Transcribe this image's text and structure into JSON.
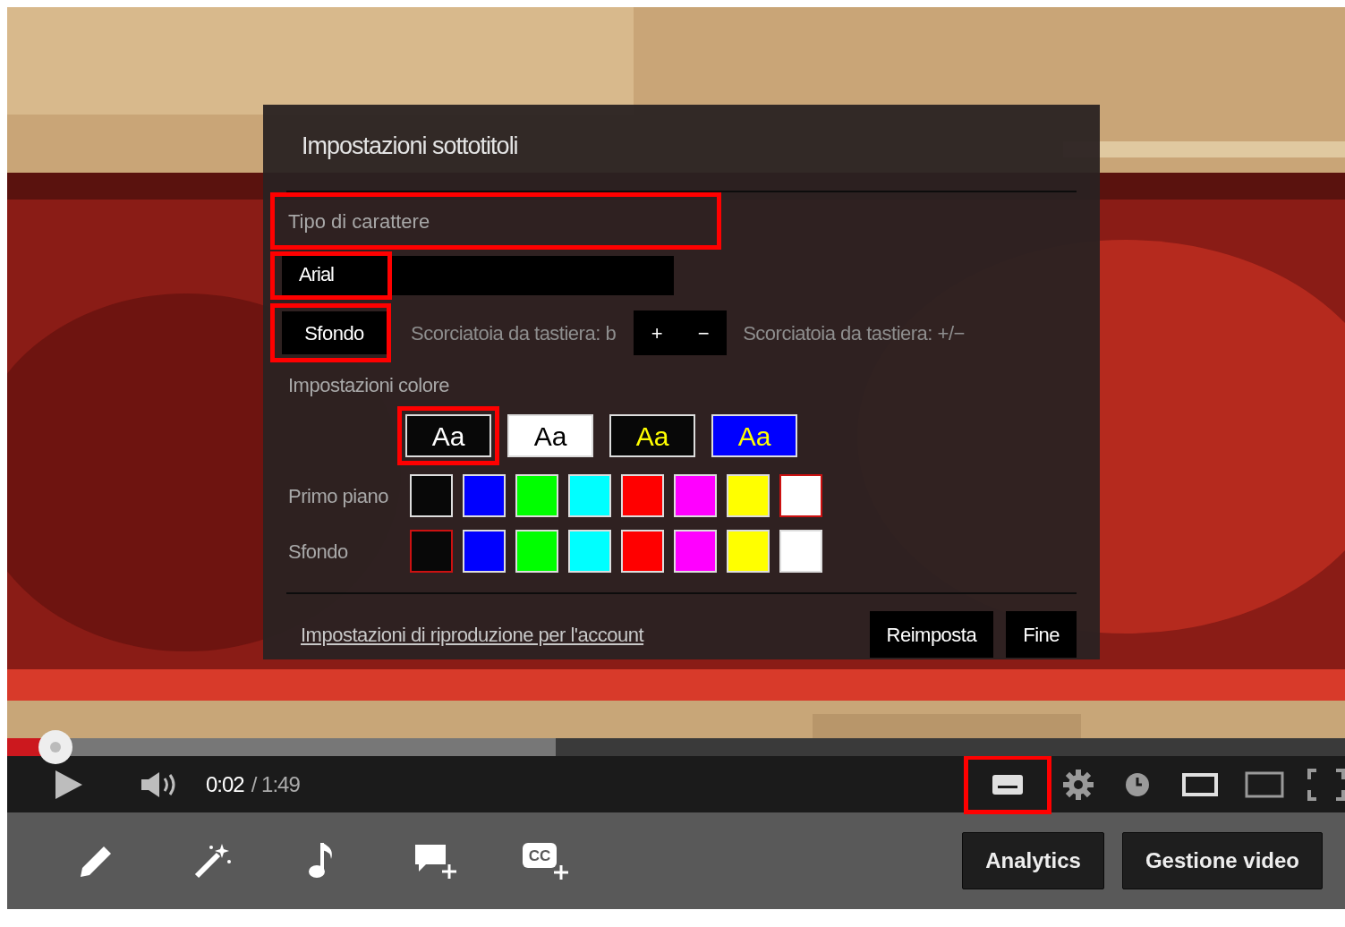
{
  "subtitle_dialog": {
    "title": "Impostazioni sottotitoli",
    "font_label": {
      "text": "Tipo di carattere",
      "highlighted": true
    },
    "font_select": {
      "value": "Arial",
      "highlighted": true
    },
    "background_button": {
      "label": "Sfondo",
      "highlighted": true
    },
    "background_shortcut": "Scorciatoia da tastiera: b",
    "size_buttons": [
      "+",
      "−"
    ],
    "size_shortcut": "Scorciatoia da tastiera: +/−",
    "color_settings_label": "Impostazioni colore",
    "presets": [
      {
        "label": "Aa",
        "kind": "white-on-black",
        "highlighted": true
      },
      {
        "label": "Aa",
        "kind": "black-on-white",
        "highlighted": false
      },
      {
        "label": "Aa",
        "kind": "yellow-on-black",
        "highlighted": false
      },
      {
        "label": "Aa",
        "kind": "yellow-on-blue",
        "highlighted": false
      }
    ],
    "foreground": {
      "label": "Primo piano",
      "swatches": [
        {
          "color": "#080808",
          "selected": false
        },
        {
          "color": "#0000ff",
          "selected": false
        },
        {
          "color": "#00ff00",
          "selected": false
        },
        {
          "color": "#00ffff",
          "selected": false
        },
        {
          "color": "#ff0000",
          "selected": false
        },
        {
          "color": "#ff00ff",
          "selected": false
        },
        {
          "color": "#ffff00",
          "selected": false
        },
        {
          "color": "#ffffff",
          "selected": true
        }
      ]
    },
    "background": {
      "label": "Sfondo",
      "swatches": [
        {
          "color": "#080808",
          "selected": true
        },
        {
          "color": "#0000ff",
          "selected": false
        },
        {
          "color": "#00ff00",
          "selected": false
        },
        {
          "color": "#00ffff",
          "selected": false
        },
        {
          "color": "#ff0000",
          "selected": false
        },
        {
          "color": "#ff00ff",
          "selected": false
        },
        {
          "color": "#ffff00",
          "selected": false
        },
        {
          "color": "#ffffff",
          "selected": false
        }
      ]
    },
    "account_link": "Impostazioni di riproduzione per l'account",
    "buttons": [
      "Reimposta",
      "Fine"
    ]
  },
  "progress": {
    "played": {
      "level": 0.036
    },
    "buffered": {
      "level": 0.41
    }
  },
  "controls": {
    "current_time": "0:02",
    "duration": "/ 1:49",
    "subtitles_highlighted": true
  },
  "toolbar": {
    "cc_label": "CC",
    "buttons": [
      "Analytics",
      "Gestione video"
    ]
  }
}
